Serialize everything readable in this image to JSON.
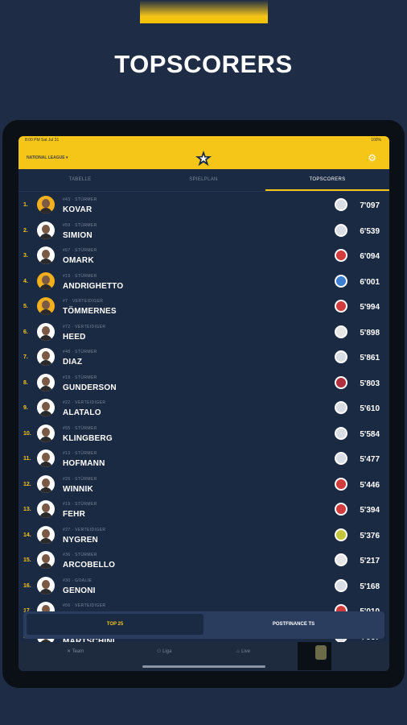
{
  "headline": "TOPSCORERS",
  "status": {
    "time": "8:00 PM  Sat Jul 31",
    "battery": "100%"
  },
  "appbar": {
    "league": "NATIONAL LEAGUE",
    "settings_icon": "gear-icon"
  },
  "tabs": [
    {
      "label": "TABELLE",
      "active": false
    },
    {
      "label": "SPIELPLAN",
      "active": false
    },
    {
      "label": "TOPSCORERS",
      "active": true
    }
  ],
  "players": [
    {
      "rank": "1.",
      "meta": "#43 · STÜRMER",
      "name": "KOVAR",
      "score": "7'097",
      "team_color": "#d9dde4",
      "avatar": "gold"
    },
    {
      "rank": "2.",
      "meta": "#59 · STÜRMER",
      "name": "SIMION",
      "score": "6'539",
      "team_color": "#d9dde4",
      "avatar": "white"
    },
    {
      "rank": "3.",
      "meta": "#67 · STÜRMER",
      "name": "OMARK",
      "score": "6'094",
      "team_color": "#d23c3c",
      "avatar": "white"
    },
    {
      "rank": "4.",
      "meta": "#19 · STÜRMER",
      "name": "ANDRIGHETTO",
      "score": "6'001",
      "team_color": "#3f7fd1",
      "avatar": "gold"
    },
    {
      "rank": "5.",
      "meta": "#7 · VERTEIDIGER",
      "name": "TÖMMERNES",
      "score": "5'994",
      "team_color": "#d23c3c",
      "avatar": "gold"
    },
    {
      "rank": "6.",
      "meta": "#72 · VERTEIDIGER",
      "name": "HEED",
      "score": "5'898",
      "team_color": "#e6e6e6",
      "avatar": "white"
    },
    {
      "rank": "7.",
      "meta": "#48 · STÜRMER",
      "name": "DIAZ",
      "score": "5'861",
      "team_color": "#d9dde4",
      "avatar": "white"
    },
    {
      "rank": "8.",
      "meta": "#18 · STÜRMER",
      "name": "GUNDERSON",
      "score": "5'803",
      "team_color": "#b03040",
      "avatar": "white"
    },
    {
      "rank": "9.",
      "meta": "#22 · VERTEIDIGER",
      "name": "ALATALO",
      "score": "5'610",
      "team_color": "#d9dde4",
      "avatar": "white"
    },
    {
      "rank": "10.",
      "meta": "#55 · STÜRMER",
      "name": "KLINGBERG",
      "score": "5'584",
      "team_color": "#d9dde4",
      "avatar": "white"
    },
    {
      "rank": "11.",
      "meta": "#13 · STÜRMER",
      "name": "HOFMANN",
      "score": "5'477",
      "team_color": "#d9dde4",
      "avatar": "white"
    },
    {
      "rank": "12.",
      "meta": "#26 · STÜRMER",
      "name": "WINNIK",
      "score": "5'446",
      "team_color": "#d23c3c",
      "avatar": "white"
    },
    {
      "rank": "13.",
      "meta": "#19 · STÜRMER",
      "name": "FEHR",
      "score": "5'394",
      "team_color": "#d23c3c",
      "avatar": "white"
    },
    {
      "rank": "14.",
      "meta": "#27 · VERTEIDIGER",
      "name": "NYGREN",
      "score": "5'376",
      "team_color": "#c5c83a",
      "avatar": "white"
    },
    {
      "rank": "15.",
      "meta": "#36 · STÜRMER",
      "name": "ARCOBELLO",
      "score": "5'217",
      "team_color": "#e6e6e6",
      "avatar": "white"
    },
    {
      "rank": "16.",
      "meta": "#30 · GOALIE",
      "name": "GENONI",
      "score": "5'168",
      "team_color": "#d9dde4",
      "avatar": "white"
    },
    {
      "rank": "17.",
      "meta": "#56 · VERTEIDIGER",
      "name": "",
      "score": "5'010",
      "team_color": "#d23c3c",
      "avatar": "white"
    },
    {
      "rank": "18.",
      "meta": "",
      "name": "MARTSCHINI",
      "score": "4'967",
      "team_color": "#d9dde4",
      "avatar": "white"
    }
  ],
  "toggle": {
    "left": "TOP 25",
    "right": "POSTFINANCE TS"
  },
  "bottomnav": {
    "team": "Team",
    "liga": "Liga",
    "live": "Live"
  }
}
